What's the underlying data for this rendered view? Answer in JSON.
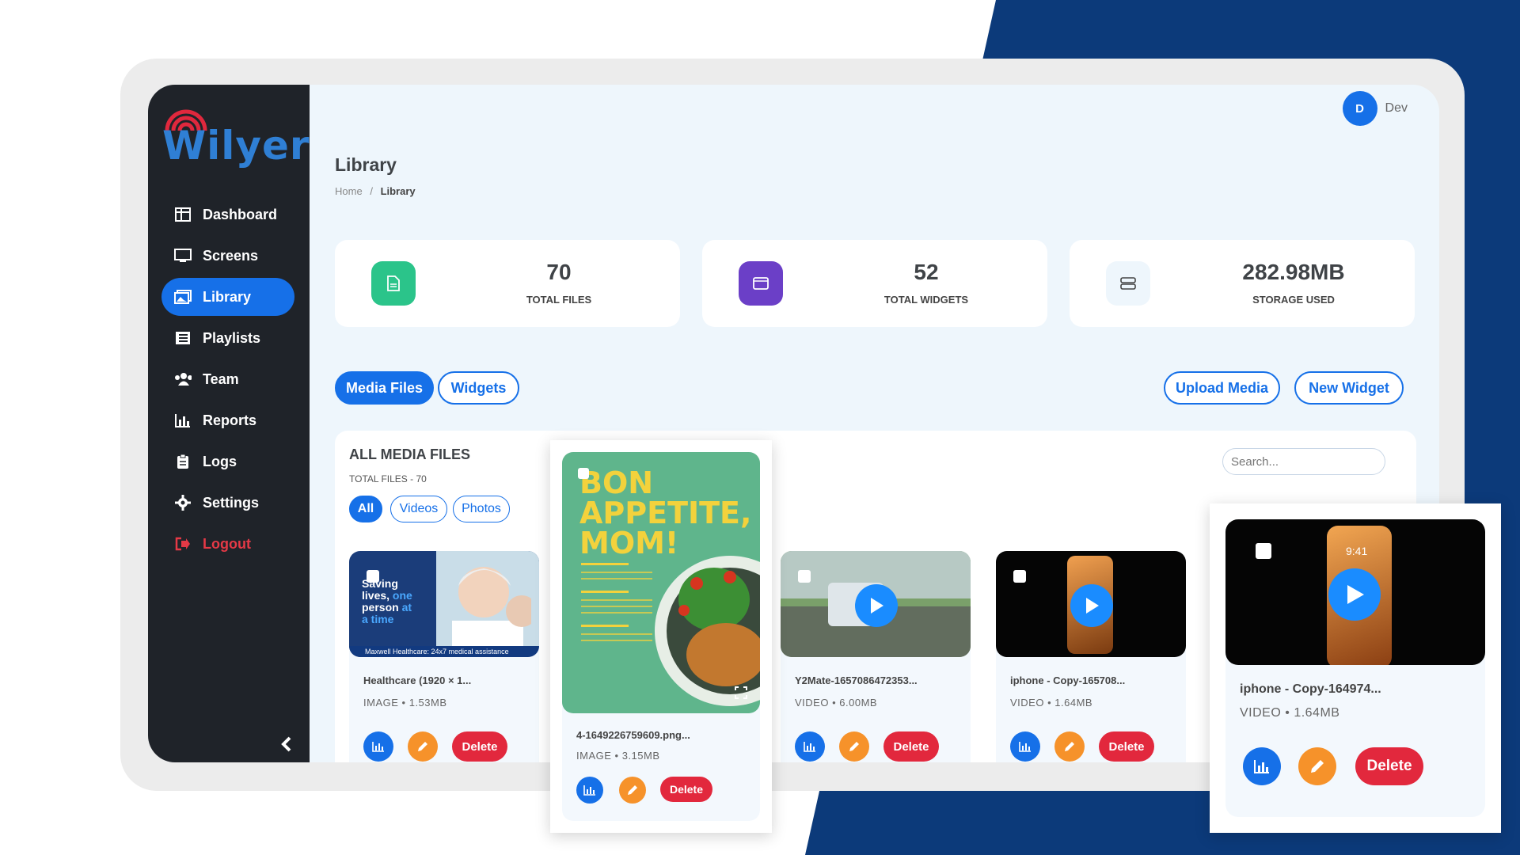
{
  "brand": {
    "name": "Wilyer",
    "accent": "#1670e8",
    "sidebar_bg": "#1f2329"
  },
  "user": {
    "initial": "D",
    "name": "Dev"
  },
  "page": {
    "title": "Library",
    "breadcrumb_home": "Home",
    "breadcrumb_sep": "/",
    "breadcrumb_current": "Library"
  },
  "sidebar": {
    "items": [
      {
        "label": "Dashboard",
        "icon": "dashboard-icon"
      },
      {
        "label": "Screens",
        "icon": "monitor-icon"
      },
      {
        "label": "Library",
        "icon": "images-icon",
        "active": true
      },
      {
        "label": "Playlists",
        "icon": "list-icon"
      },
      {
        "label": "Team",
        "icon": "users-icon"
      },
      {
        "label": "Reports",
        "icon": "bar-chart-icon"
      },
      {
        "label": "Logs",
        "icon": "clipboard-icon"
      },
      {
        "label": "Settings",
        "icon": "gear-icon"
      },
      {
        "label": "Logout",
        "icon": "logout-icon"
      }
    ]
  },
  "stats": [
    {
      "value": "70",
      "label": "TOTAL FILES",
      "color": "#2bc48a"
    },
    {
      "value": "52",
      "label": "TOTAL WIDGETS",
      "color": "#6b3fc7"
    },
    {
      "value": "282.98MB",
      "label": "STORAGE USED",
      "color": "#eef6fc"
    }
  ],
  "tabs": {
    "media": "Media Files",
    "widgets": "Widgets"
  },
  "actions": {
    "upload": "Upload Media",
    "new_widget": "New Widget"
  },
  "files": {
    "title": "ALL MEDIA FILES",
    "count": "TOTAL FILES - 70",
    "filters": [
      "All",
      "Videos",
      "Photos"
    ],
    "search_placeholder": "Search...",
    "delete_label": "Delete",
    "items": [
      {
        "name": "Healthcare (1920 × 1...",
        "type": "IMAGE",
        "size": "1.53MB",
        "thumb_text": [
          "Saving",
          "lives,",
          "one",
          "person",
          "at",
          "a time"
        ],
        "caption": "Maxwell Healthcare: 24x7 medical assistance"
      },
      {
        "name": "Y2Mate-1657086472353...",
        "type": "VIDEO",
        "size": "6.00MB"
      },
      {
        "name": "iphone - Copy-165708...",
        "type": "VIDEO",
        "size": "1.64MB"
      }
    ]
  },
  "popups": [
    {
      "name": "4-1649226759609.png...",
      "type": "IMAGE",
      "size": "3.15MB",
      "poster_title": "BON APPETITE, MOM!"
    },
    {
      "name": "iphone - Copy-164974...",
      "type": "VIDEO",
      "size": "1.64MB",
      "phone_time": "9:41"
    }
  ],
  "meta_sep": "•"
}
